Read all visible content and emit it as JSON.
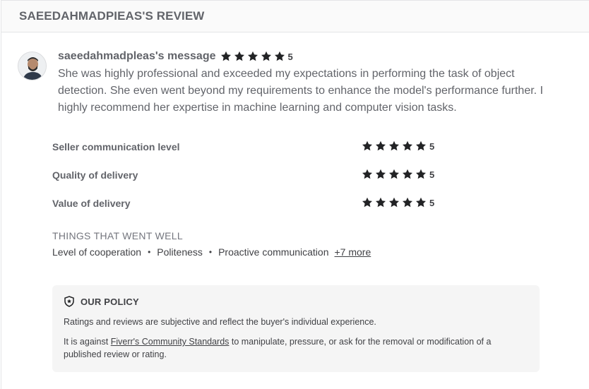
{
  "header": {
    "title": "SAEEDAHMADPIEAS'S REVIEW"
  },
  "review": {
    "username_label": "saeedahmadpleas's message",
    "rating": "5",
    "stars_count": 5,
    "message": "She was highly professional and exceeded my expectations in performing the task of object detection. She even went beyond my requirements to enhance the model's performance further. I highly recommend her expertise in machine learning and computer vision tasks."
  },
  "criteria": [
    {
      "label": "Seller communication level",
      "rating": "5"
    },
    {
      "label": "Quality of delivery",
      "rating": "5"
    },
    {
      "label": "Value of delivery",
      "rating": "5"
    }
  ],
  "things_went_well": {
    "title": "THINGS THAT WENT WELL",
    "items": [
      "Level of cooperation",
      "Politeness",
      "Proactive communication"
    ],
    "separator": "•",
    "more_label": "+7 more"
  },
  "policy": {
    "title": "OUR POLICY",
    "icon": "shield-star-icon",
    "paragraph1": "Ratings and reviews are subjective and reflect the buyer's individual experience.",
    "paragraph2_prefix": "It is against ",
    "paragraph2_link": "Fiverr's Community Standards",
    "paragraph2_suffix": " to manipulate, pressure, or ask for the removal or modification of a published review or rating."
  },
  "colors": {
    "star": "#222325",
    "text": "#404145",
    "muted": "#62646a",
    "policy_bg": "#f5f5f5"
  }
}
